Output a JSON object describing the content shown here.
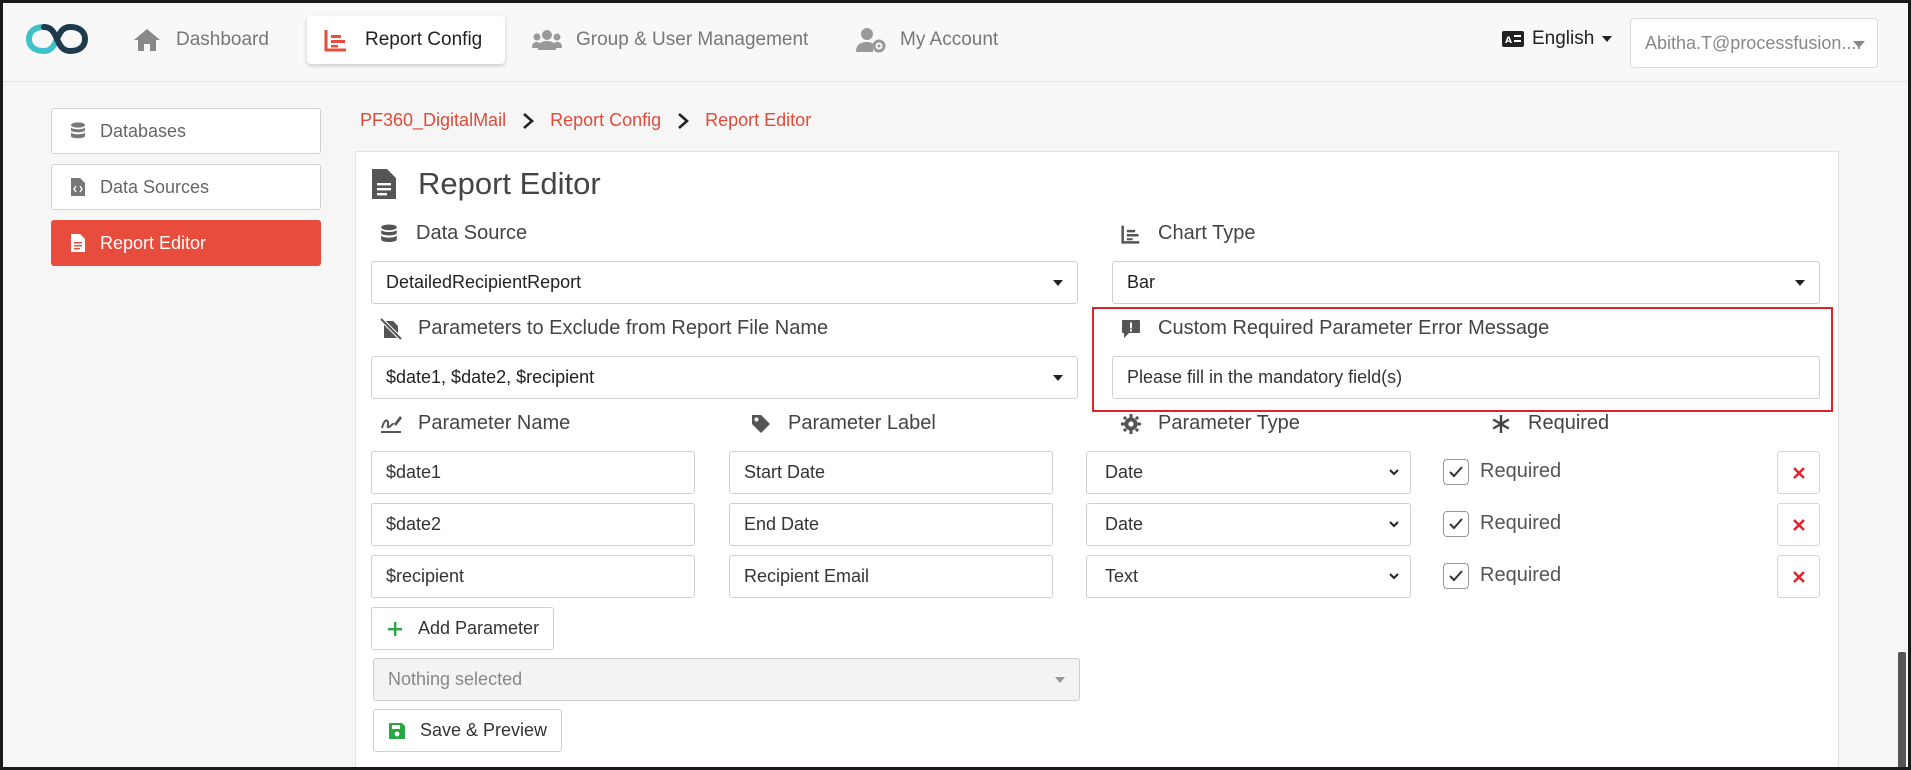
{
  "nav": {
    "items": [
      {
        "label": "Dashboard",
        "icon": "home-icon"
      },
      {
        "label": "Report Config",
        "icon": "chart-icon"
      },
      {
        "label": "Group & User Management",
        "icon": "users-icon"
      },
      {
        "label": "My Account",
        "icon": "user-cog-icon"
      }
    ],
    "active_index": 1,
    "language": "English",
    "user": "Abitha.T@processfusion...."
  },
  "sidebar": {
    "items": [
      {
        "label": "Databases",
        "icon": "database-icon"
      },
      {
        "label": "Data Sources",
        "icon": "file-code-icon"
      },
      {
        "label": "Report Editor",
        "icon": "file-alt-icon"
      }
    ],
    "active_index": 2
  },
  "breadcrumb": [
    "PF360_DigitalMail",
    "Report Config",
    "Report Editor"
  ],
  "editor": {
    "title": "Report Editor",
    "data_source_label": "Data Source",
    "data_source_value": "DetailedRecipientReport",
    "chart_type_label": "Chart Type",
    "chart_type_value": "Bar",
    "exclude_label": "Parameters to Exclude from Report File Name",
    "exclude_value": "$date1, $date2, $recipient",
    "custom_error_label": "Custom Required Parameter Error Message",
    "custom_error_value": "Please fill in the mandatory field(s)",
    "col_name": "Parameter Name",
    "col_label": "Parameter Label",
    "col_type": "Parameter Type",
    "col_required": "Required",
    "parameters": [
      {
        "name": "$date1",
        "label": "Start Date",
        "type": "Date",
        "required_text": "Required"
      },
      {
        "name": "$date2",
        "label": "End Date",
        "type": "Date",
        "required_text": "Required"
      },
      {
        "name": "$recipient",
        "label": "Recipient Email",
        "type": "Text",
        "required_text": "Required"
      }
    ],
    "add_parameter": "Add Parameter",
    "nothing_selected": "Nothing selected",
    "save_preview": "Save & Preview"
  },
  "colors": {
    "accent": "#e74c3c",
    "highlight": "#e0212b",
    "green": "#28a745",
    "logo_teal": "#3fc1c9",
    "logo_dark": "#1e3a4c"
  }
}
